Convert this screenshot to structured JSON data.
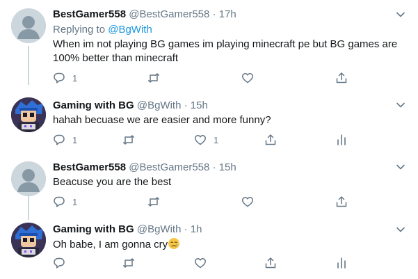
{
  "tweets": [
    {
      "display_name": "BestGamer558",
      "handle": "@BestGamer558",
      "sep": "·",
      "time": "17h",
      "replying_prefix": "Replying to",
      "replying_handle": "@BgWith",
      "text": "When im not playing BG games im playing minecraft pe but BG games are 100% better than minecraft",
      "reply_count": "1",
      "like_count": ""
    },
    {
      "display_name": "Gaming with BG",
      "handle": "@BgWith",
      "sep": "·",
      "time": "15h",
      "text": "hahah becuase we are easier and more funny?",
      "reply_count": "1",
      "like_count": "1"
    },
    {
      "display_name": "BestGamer558",
      "handle": "@BestGamer558",
      "sep": "·",
      "time": "15h",
      "text": "Beacuse you are the best",
      "reply_count": "1",
      "like_count": ""
    },
    {
      "display_name": "Gaming with BG",
      "handle": "@BgWith",
      "sep": "·",
      "time": "1h",
      "text": "Oh babe, I am gonna cry",
      "reply_count": "",
      "like_count": ""
    }
  ],
  "colors": {
    "name": "#14171a",
    "secondary": "#657786",
    "link": "#1b95e0",
    "thread_line": "#ccd6dd",
    "divider": "#e6ecf0"
  },
  "icons": [
    "chevron-down-icon",
    "reply-icon",
    "retweet-icon",
    "like-icon",
    "share-icon",
    "analytics-icon",
    "crying-face-emoji"
  ]
}
